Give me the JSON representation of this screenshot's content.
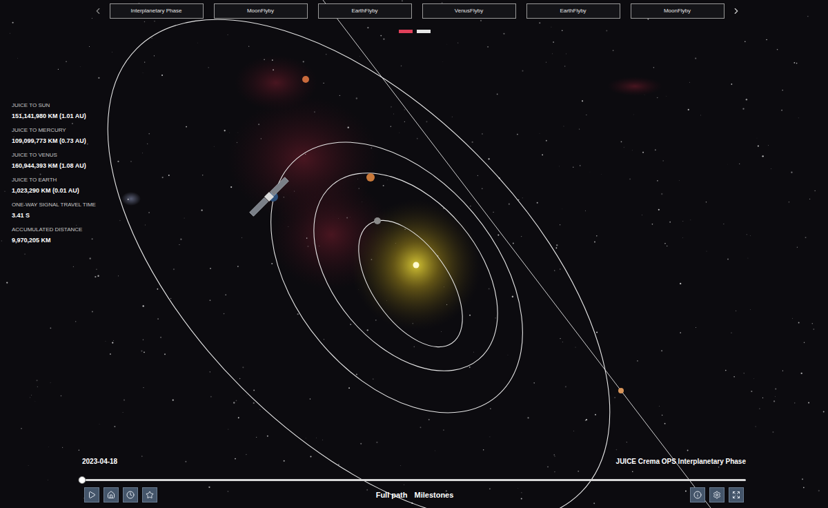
{
  "tabs": [
    {
      "label": "Interplanetary Phase",
      "selected": false
    },
    {
      "label": "MoonFlyby",
      "selected": false
    },
    {
      "label": "EarthFlyby",
      "selected": false
    },
    {
      "label": "VenusFlyby",
      "selected": false
    },
    {
      "label": "EarthFlyby",
      "selected": false
    },
    {
      "label": "MoonFlyby",
      "selected": false
    }
  ],
  "pages": [
    {
      "selected": true,
      "color": "#e0405a"
    },
    {
      "selected": false,
      "color": "#ffffff"
    }
  ],
  "stats": [
    {
      "label": "JUICE TO SUN",
      "value": "151,141,980 KM (1.01 AU)"
    },
    {
      "label": "JUICE TO MERCURY",
      "value": "109,099,773 KM (0.73 AU)"
    },
    {
      "label": "JUICE TO VENUS",
      "value": "160,944,393 KM (1.08 AU)"
    },
    {
      "label": "JUICE TO EARTH",
      "value": "1,023,290 KM (0.01 AU)"
    },
    {
      "label": "ONE-WAY SIGNAL TRAVEL TIME",
      "value": "3.41 S"
    },
    {
      "label": "ACCUMULATED DISTANCE",
      "value": "9,970,205 KM"
    }
  ],
  "date": "2023-04-18",
  "mission": "JUICE Crema OPS Interplanetary Phase",
  "timeline": {
    "level": 0
  },
  "views": [
    "Full path",
    "Milestones"
  ]
}
